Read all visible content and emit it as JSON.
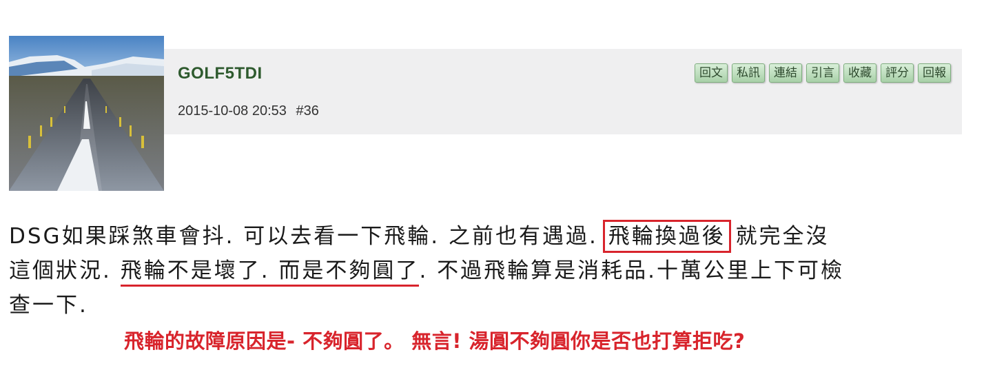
{
  "post": {
    "username": "GOLF5TDI",
    "datetime": "2015-10-08 20:53",
    "post_number": "#36"
  },
  "actions": [
    "回文",
    "私訊",
    "連結",
    "引言",
    "收藏",
    "評分",
    "回報"
  ],
  "body": {
    "line1_part1": "DSG如果踩煞車會抖. 可以去看一下飛輪. 之前也有遇過.",
    "line1_boxed": "飛輪換過後",
    "line1_part2": "就完全沒",
    "line2_part1": "這個狀況.",
    "line2_underlined": "飛輪不是壞了. 而是不夠圓了",
    "line2_part2": ". 不過飛輪算是消耗品.十萬公里上下可檢",
    "line3": "查一下."
  },
  "annotation": {
    "comment": "飛輪的故障原因是- 不夠圓了。 無言! 湯圓不夠圓你是否也打算拒吃?"
  },
  "colors": {
    "username": "#2e5a2e",
    "header_bg": "#efeff0",
    "button_green": "#a8d0a8",
    "annotation_red": "#d8242c"
  }
}
